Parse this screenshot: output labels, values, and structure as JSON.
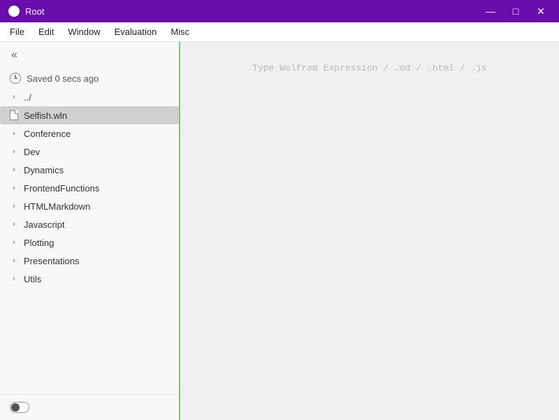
{
  "titleBar": {
    "title": "Root",
    "minimizeLabel": "—",
    "maximizeLabel": "□",
    "closeLabel": "✕"
  },
  "menuBar": {
    "items": [
      "File",
      "Edit",
      "Window",
      "Evaluation",
      "Misc"
    ]
  },
  "sidebar": {
    "collapseIcon": "«",
    "savedStatus": "Saved 0 secs ago",
    "items": [
      {
        "type": "folder",
        "label": "../",
        "expanded": false
      },
      {
        "type": "file",
        "label": "Selfish.wln",
        "selected": true
      },
      {
        "type": "folder",
        "label": "Conference",
        "expanded": false
      },
      {
        "type": "folder",
        "label": "Dev",
        "expanded": false
      },
      {
        "type": "folder",
        "label": "Dynamics",
        "expanded": false
      },
      {
        "type": "folder",
        "label": "FrontendFunctions",
        "expanded": false
      },
      {
        "type": "folder",
        "label": "HTMLMarkdown",
        "expanded": false
      },
      {
        "type": "folder",
        "label": "Javascript",
        "expanded": false
      },
      {
        "type": "folder",
        "label": "Plotting",
        "expanded": false
      },
      {
        "type": "folder",
        "label": "Presentations",
        "expanded": false
      },
      {
        "type": "folder",
        "label": "Utils",
        "expanded": false
      }
    ]
  },
  "editor": {
    "placeholder": "Type Wolfram Expression / .md / .html / .js"
  }
}
